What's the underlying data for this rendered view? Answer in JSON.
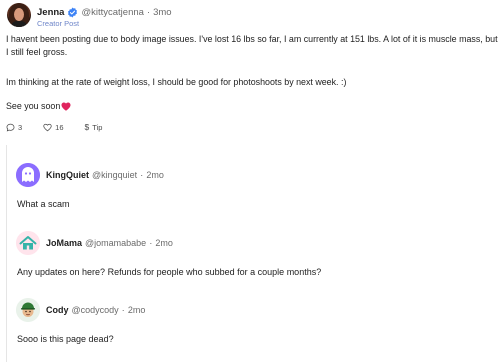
{
  "post": {
    "author_name": "Jenna",
    "author_handle": "@kittycatjenna",
    "separator": "·",
    "time_ago": "3mo",
    "creator_tag": "Creator Post",
    "paragraph_1": "I havent been posting due to body image issues. I've lost 16 lbs so far, I am currently at 151 lbs. A lot of it is muscle mass, but I still feel gross.",
    "paragraph_2": "Im thinking at the rate of weight loss, I should be good for photoshoots by next week. :)",
    "paragraph_3": "See you soon",
    "actions": {
      "reply_count": "3",
      "like_count": "16",
      "tip_glyph": "$",
      "tip_label": "Tip"
    }
  },
  "comments": [
    {
      "name": "KingQuiet",
      "handle": "@kingquiet",
      "separator": "·",
      "time_ago": "2mo",
      "text": "What a scam"
    },
    {
      "name": "JoMama",
      "handle": "@jomamababe",
      "separator": "·",
      "time_ago": "2mo",
      "text": "Any updates on here? Refunds for people who subbed for a couple months?"
    },
    {
      "name": "Cody",
      "handle": "@codycody",
      "separator": "·",
      "time_ago": "2mo",
      "text": "Sooo is this page dead?"
    }
  ],
  "icons": {
    "verified": "verified-badge-icon",
    "heart_emoji": "red-heart-emoji",
    "reply": "speech-bubble-icon",
    "like": "heart-outline-icon",
    "tip": "dollar-sign-icon"
  },
  "colors": {
    "verified_blue": "#3b82f6",
    "creator_tag": "#6f86c9",
    "heart_red": "#e0245e",
    "king_avatar": "#8b6dff",
    "jo_avatar_house": "#35b3a8"
  }
}
